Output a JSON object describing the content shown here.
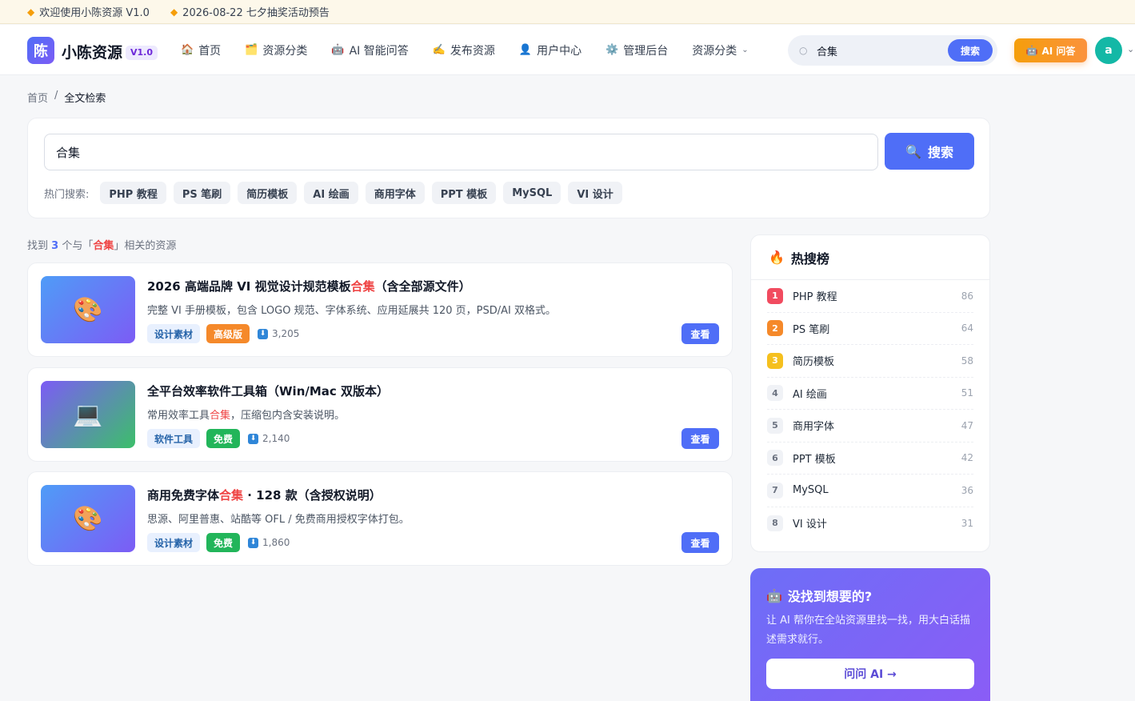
{
  "notice": {
    "items": [
      {
        "icon": "megaphone-icon",
        "text": "欢迎使用小陈资源 V1.0"
      },
      {
        "icon": "megaphone-icon",
        "text": "2026-08-22 七夕抽奖活动预告"
      }
    ]
  },
  "header": {
    "logo_char": "陈",
    "site_name": "小陈资源",
    "version": "V1.0",
    "nav": [
      {
        "icon": "🏠",
        "label": "首页"
      },
      {
        "icon": "🗂️",
        "label": "资源分类"
      },
      {
        "icon": "🤖",
        "label": "AI 智能问答"
      },
      {
        "icon": "✍️",
        "label": "发布资源"
      },
      {
        "icon": "👤",
        "label": "用户中心"
      },
      {
        "icon": "⚙️",
        "label": "管理后台"
      },
      {
        "icon": "",
        "label": "资源分类"
      }
    ],
    "nav_dropdown_icon": "chevron-down-icon",
    "search": {
      "value": "合集",
      "button": "搜索"
    },
    "ai_button": "AI 问答",
    "avatar_letter": "a"
  },
  "breadcrumb": {
    "home": "首页",
    "sep": "/",
    "current": "全文检索"
  },
  "search_panel": {
    "query": "合集",
    "button": "搜索",
    "hot_label": "热门搜索:",
    "hot_tags": [
      "PHP 教程",
      "PS 笔刷",
      "简历模板",
      "AI 绘画",
      "商用字体",
      "PPT 模板",
      "MySQL",
      "VI 设计"
    ]
  },
  "results_summary": {
    "pre": "找到",
    "count": "3",
    "mid": "个与「",
    "keyword": "合集",
    "post": "」相关的资源"
  },
  "results": [
    {
      "thumb": "🎨",
      "title_pre": "2026 高端品牌 VI 视觉设计规范模板",
      "title_hl": "合集",
      "title_post": "（含全部源文件）",
      "desc_pre": "完整 VI 手册模板，包含 LOGO 规范、字体系统、应用延展共 120 页，PSD/AI 双格式。",
      "desc_hl": "",
      "desc_post": "",
      "category": "设计素材",
      "badge": "高级版",
      "badge_type": "pro",
      "downloads": "3,205",
      "view": "查看"
    },
    {
      "thumb": "💻",
      "title_pre": "全平台效率软件工具箱（Win/Mac 双版本）",
      "title_hl": "",
      "title_post": "",
      "desc_pre": "常用效率工具",
      "desc_hl": "合集",
      "desc_post": "，压缩包内含安装说明。",
      "category": "软件工具",
      "badge": "免费",
      "badge_type": "free",
      "downloads": "2,140",
      "view": "查看"
    },
    {
      "thumb": "🎨",
      "title_pre": "商用免费字体",
      "title_hl": "合集",
      "title_post": " · 128 款（含授权说明）",
      "desc_pre": "思源、阿里普惠、站酷等 OFL / 免费商用授权字体打包。",
      "desc_hl": "",
      "desc_post": "",
      "category": "设计素材",
      "badge": "免费",
      "badge_type": "free",
      "downloads": "1,860",
      "view": "查看"
    }
  ],
  "hot_rank": {
    "icon": "🔥",
    "title": "热搜榜",
    "items": [
      {
        "rank": "1",
        "name": "PHP 教程",
        "count": "86"
      },
      {
        "rank": "2",
        "name": "PS 笔刷",
        "count": "64"
      },
      {
        "rank": "3",
        "name": "简历模板",
        "count": "58"
      },
      {
        "rank": "4",
        "name": "AI 绘画",
        "count": "51"
      },
      {
        "rank": "5",
        "name": "商用字体",
        "count": "47"
      },
      {
        "rank": "6",
        "name": "PPT 模板",
        "count": "42"
      },
      {
        "rank": "7",
        "name": "MySQL",
        "count": "36"
      },
      {
        "rank": "8",
        "name": "VI 设计",
        "count": "31"
      }
    ]
  },
  "promo": {
    "title": "没找到想要的?",
    "desc": "让 AI 帮你在全站资源里找一找，用大白话描述需求就行。",
    "button": "问问 AI →"
  }
}
